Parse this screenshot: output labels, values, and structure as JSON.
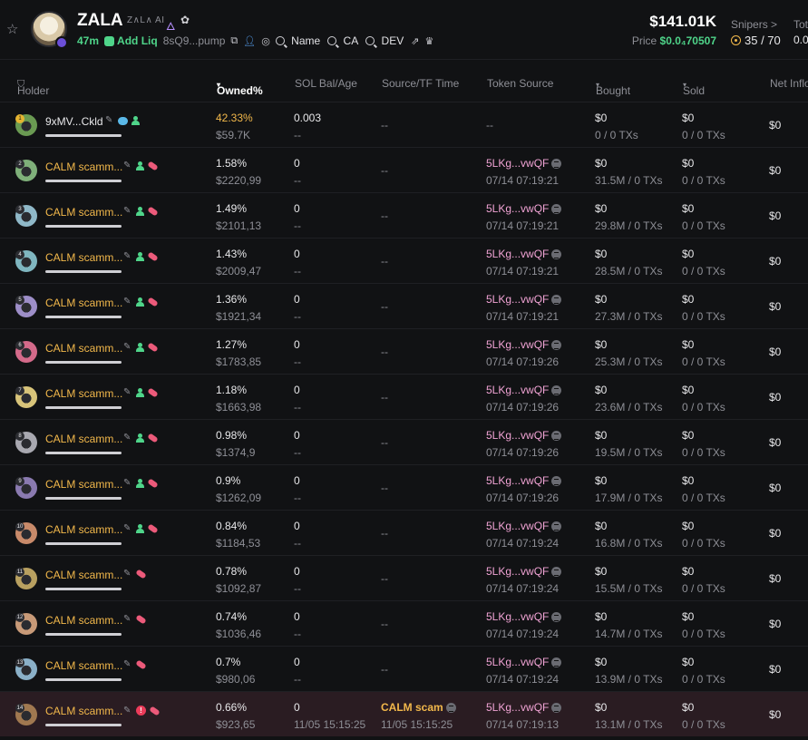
{
  "header": {
    "token_name": "ZALA",
    "token_subname": "Z∧L∧ AI",
    "age": "47m",
    "add_liq_label": "Add Liq",
    "contract_short": "8sQ9...pump",
    "search_name_label": "Name",
    "search_ca_label": "CA",
    "search_dev_label": "DEV",
    "market_cap": "$141.01K",
    "price_label": "Price",
    "price_value": "$0.0₄70507",
    "snipers_label": "Snipers >",
    "snipers_value": "35 / 70",
    "tot_label": "Tot",
    "tot_value": "0.0"
  },
  "columns": {
    "holder": "Holder",
    "owned": "Owned%",
    "sol_bal": "SOL Bal/Age",
    "source": "Source/TF Time",
    "token_source": "Token Source",
    "bought": "Bought",
    "sold": "Sold",
    "net": "Net Inflo"
  },
  "colors": {
    "accent_green": "#4fd58a",
    "holder_orange": "#f2b84b",
    "token_pink": "#f0a3d4",
    "highlight_row": "#2a1c22"
  },
  "rows": [
    {
      "rank": "1",
      "name": "9xMV...Ckld",
      "owned_pct": "42.33%",
      "owned_usd": "$59.7K",
      "sol": "0.003",
      "sol_age": "--",
      "source": "--",
      "token_source": "--",
      "token_time": "",
      "bought": "$0",
      "bought_tx": "0 / 0 TXs",
      "sold": "$0",
      "sold_tx": "0 / 0 TXs",
      "net": "$0",
      "avatar": "#6a9a52"
    },
    {
      "rank": "2",
      "name": "CALM scamm...",
      "owned_pct": "1.58%",
      "owned_usd": "$2220,99",
      "sol": "0",
      "sol_age": "--",
      "source": "--",
      "token_source": "5LKg...vwQF",
      "token_time": "07/14 07:19:21",
      "bought": "$0",
      "bought_tx": "31.5M / 0 TXs",
      "sold": "$0",
      "sold_tx": "0 / 0 TXs",
      "net": "$0",
      "avatar": "#7fb07a"
    },
    {
      "rank": "3",
      "name": "CALM scamm...",
      "owned_pct": "1.49%",
      "owned_usd": "$2101,13",
      "sol": "0",
      "sol_age": "--",
      "source": "--",
      "token_source": "5LKg...vwQF",
      "token_time": "07/14 07:19:21",
      "bought": "$0",
      "bought_tx": "29.8M / 0 TXs",
      "sold": "$0",
      "sold_tx": "0 / 0 TXs",
      "net": "$0",
      "avatar": "#8fb8c8"
    },
    {
      "rank": "4",
      "name": "CALM scamm...",
      "owned_pct": "1.43%",
      "owned_usd": "$2009,47",
      "sol": "0",
      "sol_age": "--",
      "source": "--",
      "token_source": "5LKg...vwQF",
      "token_time": "07/14 07:19:21",
      "bought": "$0",
      "bought_tx": "28.5M / 0 TXs",
      "sold": "$0",
      "sold_tx": "0 / 0 TXs",
      "net": "$0",
      "avatar": "#7fb6c0"
    },
    {
      "rank": "5",
      "name": "CALM scamm...",
      "owned_pct": "1.36%",
      "owned_usd": "$1921,34",
      "sol": "0",
      "sol_age": "--",
      "source": "--",
      "token_source": "5LKg...vwQF",
      "token_time": "07/14 07:19:21",
      "bought": "$0",
      "bought_tx": "27.3M / 0 TXs",
      "sold": "$0",
      "sold_tx": "0 / 0 TXs",
      "net": "$0",
      "avatar": "#9d8ec8"
    },
    {
      "rank": "6",
      "name": "CALM scamm...",
      "owned_pct": "1.27%",
      "owned_usd": "$1783,85",
      "sol": "0",
      "sol_age": "--",
      "source": "--",
      "token_source": "5LKg...vwQF",
      "token_time": "07/14 07:19:26",
      "bought": "$0",
      "bought_tx": "25.3M / 0 TXs",
      "sold": "$0",
      "sold_tx": "0 / 0 TXs",
      "net": "$0",
      "avatar": "#d46a8a"
    },
    {
      "rank": "7",
      "name": "CALM scamm...",
      "owned_pct": "1.18%",
      "owned_usd": "$1663,98",
      "sol": "0",
      "sol_age": "--",
      "source": "--",
      "token_source": "5LKg...vwQF",
      "token_time": "07/14 07:19:26",
      "bought": "$0",
      "bought_tx": "23.6M / 0 TXs",
      "sold": "$0",
      "sold_tx": "0 / 0 TXs",
      "net": "$0",
      "avatar": "#d8c47a"
    },
    {
      "rank": "8",
      "name": "CALM scamm...",
      "owned_pct": "0.98%",
      "owned_usd": "$1374,9",
      "sol": "0",
      "sol_age": "--",
      "source": "--",
      "token_source": "5LKg...vwQF",
      "token_time": "07/14 07:19:26",
      "bought": "$0",
      "bought_tx": "19.5M / 0 TXs",
      "sold": "$0",
      "sold_tx": "0 / 0 TXs",
      "net": "$0",
      "avatar": "#a8a8b0"
    },
    {
      "rank": "9",
      "name": "CALM scamm...",
      "owned_pct": "0.9%",
      "owned_usd": "$1262,09",
      "sol": "0",
      "sol_age": "--",
      "source": "--",
      "token_source": "5LKg...vwQF",
      "token_time": "07/14 07:19:26",
      "bought": "$0",
      "bought_tx": "17.9M / 0 TXs",
      "sold": "$0",
      "sold_tx": "0 / 0 TXs",
      "net": "$0",
      "avatar": "#8a7ab0"
    },
    {
      "rank": "10",
      "name": "CALM scamm...",
      "owned_pct": "0.84%",
      "owned_usd": "$1184,53",
      "sol": "0",
      "sol_age": "--",
      "source": "--",
      "token_source": "5LKg...vwQF",
      "token_time": "07/14 07:19:24",
      "bought": "$0",
      "bought_tx": "16.8M / 0 TXs",
      "sold": "$0",
      "sold_tx": "0 / 0 TXs",
      "net": "$0",
      "avatar": "#c88a6a"
    },
    {
      "rank": "11",
      "name": "CALM scamm...",
      "owned_pct": "0.78%",
      "owned_usd": "$1092,87",
      "sol": "0",
      "sol_age": "--",
      "source": "--",
      "token_source": "5LKg...vwQF",
      "token_time": "07/14 07:19:24",
      "bought": "$0",
      "bought_tx": "15.5M / 0 TXs",
      "sold": "$0",
      "sold_tx": "0 / 0 TXs",
      "net": "$0",
      "avatar": "#b8a060"
    },
    {
      "rank": "12",
      "name": "CALM scamm...",
      "owned_pct": "0.74%",
      "owned_usd": "$1036,46",
      "sol": "0",
      "sol_age": "--",
      "source": "--",
      "token_source": "5LKg...vwQF",
      "token_time": "07/14 07:19:24",
      "bought": "$0",
      "bought_tx": "14.7M / 0 TXs",
      "sold": "$0",
      "sold_tx": "0 / 0 TXs",
      "net": "$0",
      "avatar": "#c89a78"
    },
    {
      "rank": "13",
      "name": "CALM scamm...",
      "owned_pct": "0.7%",
      "owned_usd": "$980,06",
      "sol": "0",
      "sol_age": "--",
      "source": "--",
      "token_source": "5LKg...vwQF",
      "token_time": "07/14 07:19:24",
      "bought": "$0",
      "bought_tx": "13.9M / 0 TXs",
      "sold": "$0",
      "sold_tx": "0 / 0 TXs",
      "net": "$0",
      "avatar": "#8ab0c8"
    },
    {
      "rank": "14",
      "name": "CALM scamm...",
      "owned_pct": "0.66%",
      "owned_usd": "$923,65",
      "sol": "0",
      "sol_age": "11/05 15:15:25",
      "source": "CALM scam",
      "source_time": "11/05 15:15:25",
      "token_source": "5LKg...vwQF",
      "token_time": "07/14 07:19:13",
      "bought": "$0",
      "bought_tx": "13.1M / 0 TXs",
      "sold": "$0",
      "sold_tx": "0 / 0 TXs",
      "net": "$0",
      "avatar": "#a07850",
      "highlight": true,
      "warning": true
    }
  ]
}
